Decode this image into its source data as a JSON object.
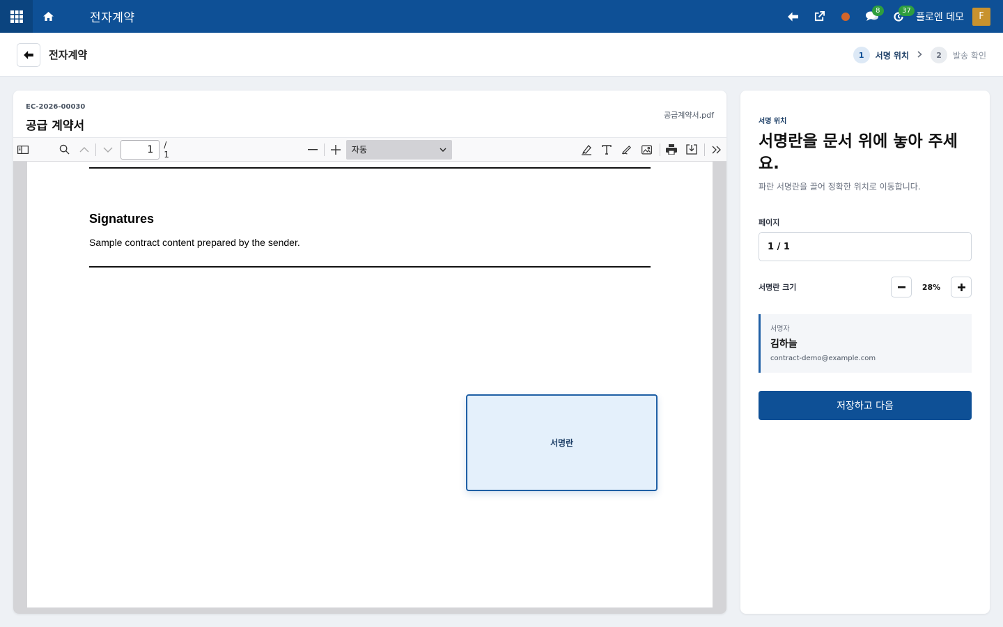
{
  "topnav": {
    "title": "전자계약",
    "user_name": "플로엔 데모",
    "avatar_letter": "F",
    "chat_badge": "8",
    "activity_badge": "37",
    "colors": {
      "bar": "#0e5096",
      "status_dot": "#d2652a",
      "badge": "#2e9e3e"
    }
  },
  "subheader": {
    "title": "전자계약",
    "steps": [
      {
        "num": "1",
        "label": "서명 위치"
      },
      {
        "num": "2",
        "label": "발송 확인"
      }
    ]
  },
  "document": {
    "id": "EC-2026-00030",
    "title": "공급 계약서",
    "file_name": "공급계약서.pdf",
    "toolbar": {
      "page_value": "1",
      "page_total": "/ 1",
      "zoom_label": "자동"
    },
    "page": {
      "heading": "Signatures",
      "body": "Sample contract content prepared by the sender.",
      "signature_box_label": "서명란"
    }
  },
  "side_panel": {
    "eyebrow": "서명 위치",
    "heading": "서명란을 문서 위에 놓아 주세요.",
    "description": "파란 서명란을 끌어 정확한 위치로 이동합니다.",
    "page_label": "페이지",
    "page_value": "1 / 1",
    "size_label": "서명란 크기",
    "size_value": "28%",
    "signer": {
      "caption": "서명자",
      "name": "김하늘",
      "email": "contract-demo@example.com"
    },
    "save_button": "저장하고 다음"
  }
}
